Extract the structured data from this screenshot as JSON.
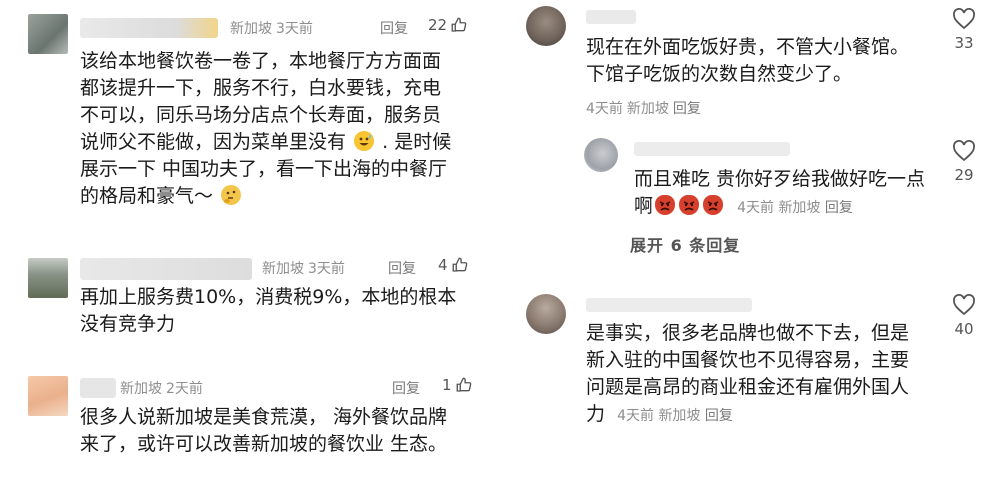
{
  "left_comments": [
    {
      "location": "新加坡",
      "time": "3天前",
      "reply_label": "回复",
      "likes": "22",
      "lines": [
        "该给本地餐饮卷一卷了，本地餐厅方方面面",
        "都该提升一下，服务不行，白水要钱，充电",
        "不可以，同乐马场分店点个长寿面，服务员",
        "说师父不能做，因为菜单里没有",
        "展示一下 中国功夫了，看一下出海的中餐厅",
        "的格局和豪气～"
      ],
      "line4_suffix": ". 是时候",
      "emoji_1": "sweat-smile-emoji",
      "emoji_2": "thinking-emoji"
    },
    {
      "location": "新加坡",
      "time": "3天前",
      "reply_label": "回复",
      "likes": "4",
      "lines": [
        "再加上服务费10%，消费税9%，本地的根本",
        "没有竞争力"
      ]
    },
    {
      "location": "新加坡",
      "time": "2天前",
      "reply_label": "回复",
      "likes": "1",
      "lines": [
        "很多人说新加坡是美食荒漠， 海外餐饮品牌",
        "来了，或许可以改善新加坡的餐饮业 生态。"
      ]
    }
  ],
  "right_comments": [
    {
      "likes": "33",
      "lines": [
        "现在在外面吃饭好贵，不管大小餐馆。",
        "下馆子吃饭的次数自然变少了。"
      ],
      "time": "4天前",
      "location": "新加坡",
      "reply_label": "回复"
    },
    {
      "likes": "29",
      "lines": [
        "而且难吃 贵你好歹给我做好吃一点",
        "啊"
      ],
      "time": "4天前",
      "location": "新加坡",
      "reply_label": "回复",
      "emoji": "angry-face-emoji"
    },
    {
      "likes": "40",
      "lines": [
        "是事实，很多老品牌也做不下去，但是",
        "新入驻的中国餐饮也不见得容易，主要",
        "问题是高昂的商业租金还有雇佣外国人",
        "力"
      ],
      "time": "4天前",
      "location": "新加坡",
      "reply_label": "回复"
    }
  ],
  "expand_replies": "展开 6 条回复",
  "colors": {
    "heart_stroke": "#555555",
    "meta_gray": "#8e8e8e"
  }
}
